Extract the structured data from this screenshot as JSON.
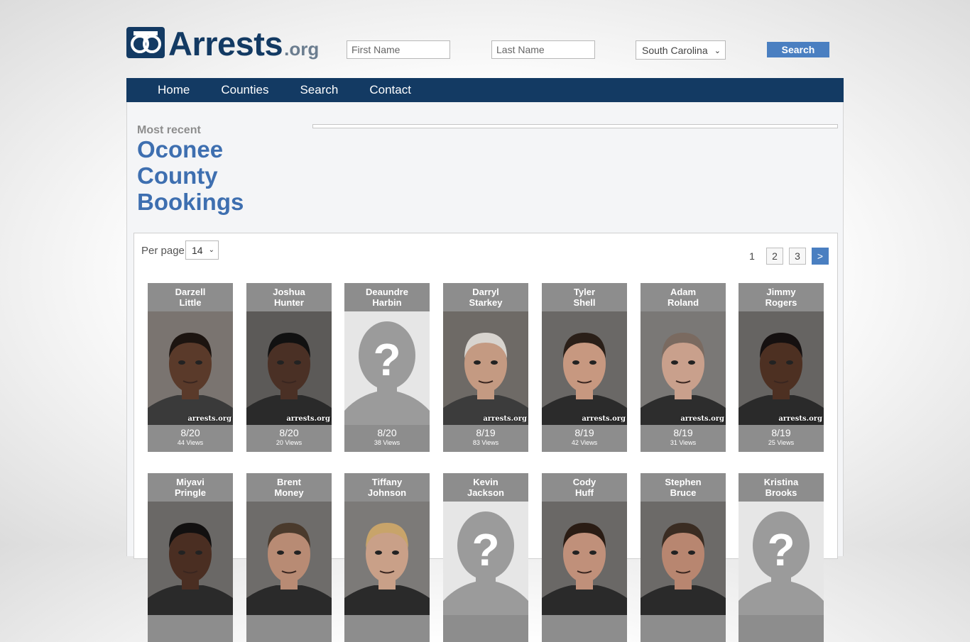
{
  "header": {
    "logo_text": "Arrests",
    "logo_suffix": ".org",
    "first_name_placeholder": "First Name",
    "last_name_placeholder": "Last Name",
    "state_selected": "South Carolina",
    "search_label": "Search"
  },
  "nav": {
    "items": [
      {
        "label": "Home"
      },
      {
        "label": "Counties"
      },
      {
        "label": "Search"
      },
      {
        "label": "Contact"
      }
    ]
  },
  "page": {
    "eyebrow": "Most recent",
    "title_line1": "Oconee",
    "title_line2": "County",
    "title_line3": "Bookings"
  },
  "results": {
    "per_page_label": "Per page",
    "per_page_value": "14",
    "pagination": {
      "current": "1",
      "pages": [
        "2",
        "3"
      ],
      "next": ">"
    },
    "bookings": [
      {
        "first": "Darzell",
        "last": "Little",
        "date": "8/20",
        "views": "44 Views",
        "photo": "mugshot",
        "skin": "#5a3a2a",
        "hair": "#1c1410",
        "shirt": "#3a3a3a",
        "bg": "#7a7470",
        "watermark": "arrests.org"
      },
      {
        "first": "Joshua",
        "last": "Hunter",
        "date": "8/20",
        "views": "20 Views",
        "photo": "mugshot",
        "skin": "#4a3025",
        "hair": "#111111",
        "shirt": "#2a2a2a",
        "bg": "#5c5a58",
        "watermark": "arrests.org"
      },
      {
        "first": "Deaundre",
        "last": "Harbin",
        "date": "8/20",
        "views": "38 Views",
        "photo": "placeholder",
        "skin": "#9a9a9a",
        "hair": "#9a9a9a",
        "shirt": "#9a9a9a",
        "bg": "#e6e6e6",
        "watermark": ""
      },
      {
        "first": "Darryl",
        "last": "Starkey",
        "date": "8/19",
        "views": "83 Views",
        "photo": "mugshot",
        "skin": "#c49a82",
        "hair": "#d8d4cf",
        "shirt": "#3c3c3c",
        "bg": "#6e6a66",
        "watermark": "arrests.org"
      },
      {
        "first": "Tyler",
        "last": "Shell",
        "date": "8/19",
        "views": "42 Views",
        "photo": "mugshot",
        "skin": "#c79880",
        "hair": "#2a1f18",
        "shirt": "#2b2b2b",
        "bg": "#6a6866",
        "watermark": "arrests.org"
      },
      {
        "first": "Adam",
        "last": "Roland",
        "date": "8/19",
        "views": "31 Views",
        "photo": "mugshot",
        "skin": "#c9a08c",
        "hair": "#7a6a60",
        "shirt": "#2d2d2d",
        "bg": "#7a7876",
        "watermark": "arrests.org"
      },
      {
        "first": "Jimmy",
        "last": "Rogers",
        "date": "8/19",
        "views": "25 Views",
        "photo": "mugshot",
        "skin": "#4d3022",
        "hair": "#151010",
        "shirt": "#2a2a2a",
        "bg": "#666462",
        "watermark": "arrests.org"
      },
      {
        "first": "Miyavi",
        "last": "Pringle",
        "date": "",
        "views": "",
        "photo": "mugshot",
        "skin": "#4a2e22",
        "hair": "#121010",
        "shirt": "#2a2a2a",
        "bg": "#6a6866",
        "watermark": ""
      },
      {
        "first": "Brent",
        "last": "Money",
        "date": "",
        "views": "",
        "photo": "mugshot",
        "skin": "#b88b74",
        "hair": "#4a3a2c",
        "shirt": "#2a2a2a",
        "bg": "#6e6c6a",
        "watermark": ""
      },
      {
        "first": "Tiffany",
        "last": "Johnson",
        "date": "",
        "views": "",
        "photo": "mugshot",
        "skin": "#c9a088",
        "hair": "#c8a46a",
        "shirt": "#2a2a2a",
        "bg": "#7c7a78",
        "watermark": ""
      },
      {
        "first": "Kevin",
        "last": "Jackson",
        "date": "",
        "views": "",
        "photo": "placeholder",
        "skin": "#9a9a9a",
        "hair": "#9a9a9a",
        "shirt": "#9a9a9a",
        "bg": "#e6e6e6",
        "watermark": ""
      },
      {
        "first": "Cody",
        "last": "Huff",
        "date": "",
        "views": "",
        "photo": "mugshot",
        "skin": "#c0907a",
        "hair": "#2a1c14",
        "shirt": "#2a2a2a",
        "bg": "#6a6866",
        "watermark": ""
      },
      {
        "first": "Stephen",
        "last": "Bruce",
        "date": "",
        "views": "",
        "photo": "mugshot",
        "skin": "#b88670",
        "hair": "#3a2c22",
        "shirt": "#2a2a2a",
        "bg": "#6c6a68",
        "watermark": ""
      },
      {
        "first": "Kristina",
        "last": "Brooks",
        "date": "",
        "views": "",
        "photo": "placeholder",
        "skin": "#9a9a9a",
        "hair": "#9a9a9a",
        "shirt": "#9a9a9a",
        "bg": "#e6e6e6",
        "watermark": ""
      }
    ]
  }
}
